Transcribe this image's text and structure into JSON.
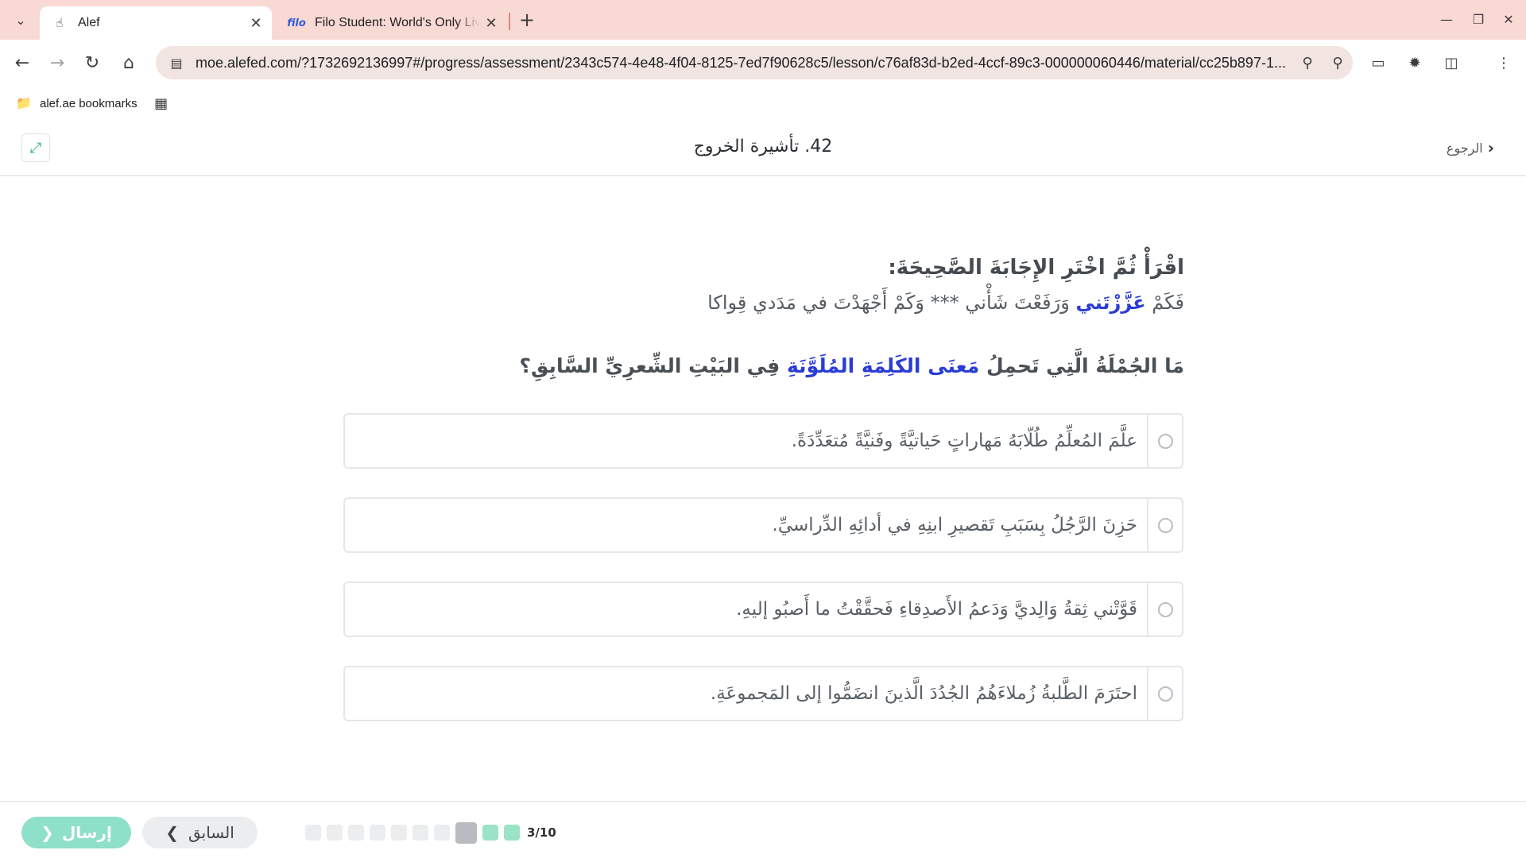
{
  "browser": {
    "tabs": [
      {
        "title": "Alef",
        "favicon": "alef-icon",
        "active": true
      },
      {
        "title": "Filo Student: World's Only Live Instant Tutoring Platform",
        "favicon_text": "filo",
        "active": false
      }
    ],
    "url": "moe.alefed.com/?1732692136997#/progress/assessment/2343c574-4e48-4f04-8125-7ed7f90628c5/lesson/c76af83d-b2ed-4ccf-89c3-000000060446/material/cc25b897-1...",
    "bookmarks": {
      "folder_label": "alef.ae bookmarks"
    },
    "accent_color": "#f9d9d3"
  },
  "header": {
    "title": "42. تأشيرة الخروج",
    "back_label": "الرجوع"
  },
  "question": {
    "instruction": "اقْرَأْ ثُمَّ اخْتَرِ الإِجَابَةَ الصَّحِيحَةَ:",
    "verse_before": "فَكَمْ ",
    "verse_highlight": "عَزَّزْتَني",
    "verse_after": " وَرَفَعْتَ شَأْني  *** وَكَمْ أَجْهَدْتَ في مَدَدي قِواكا",
    "prompt_before": "مَا الجُمْلَةُ الَّتِي تَحمِلُ ",
    "prompt_highlight": "مَعنَى الكَلِمَةِ المُلَوَّنَةِ",
    "prompt_after": " فِي البَيْتِ الشِّعرِيِّ السَّابِقِ؟",
    "highlight_color": "#2a3dd6"
  },
  "options": [
    {
      "text": "علَّمَ المُعلِّمُ طُلّابَهُ مَهاراتٍ حَياتيَّةً وفَنيَّةً مُتعَدِّدَةً."
    },
    {
      "text": "حَزِنَ الرَّجُلُ بِسَبَبِ تَقصيرِ ابنِهِ في أدائِهِ الدِّراسيِّ."
    },
    {
      "text": "قَوَّتْني ثِقةُ وَالِديَّ وَدَعمُ الأَصدِقاءِ فَحقَّقْتُ ما أَصبُو إليهِ."
    },
    {
      "text": "احتَرَمَ الطَّلبةُ زُملاءَهُمُ الجُدُدَ الَّذينَ انضَمُّوا إلى المَجموعَةِ."
    }
  ],
  "footer": {
    "submit_label": "إرسال",
    "prev_label": "السابق",
    "progress_label": "3/10",
    "progress": {
      "current": 3,
      "total": 10
    }
  }
}
